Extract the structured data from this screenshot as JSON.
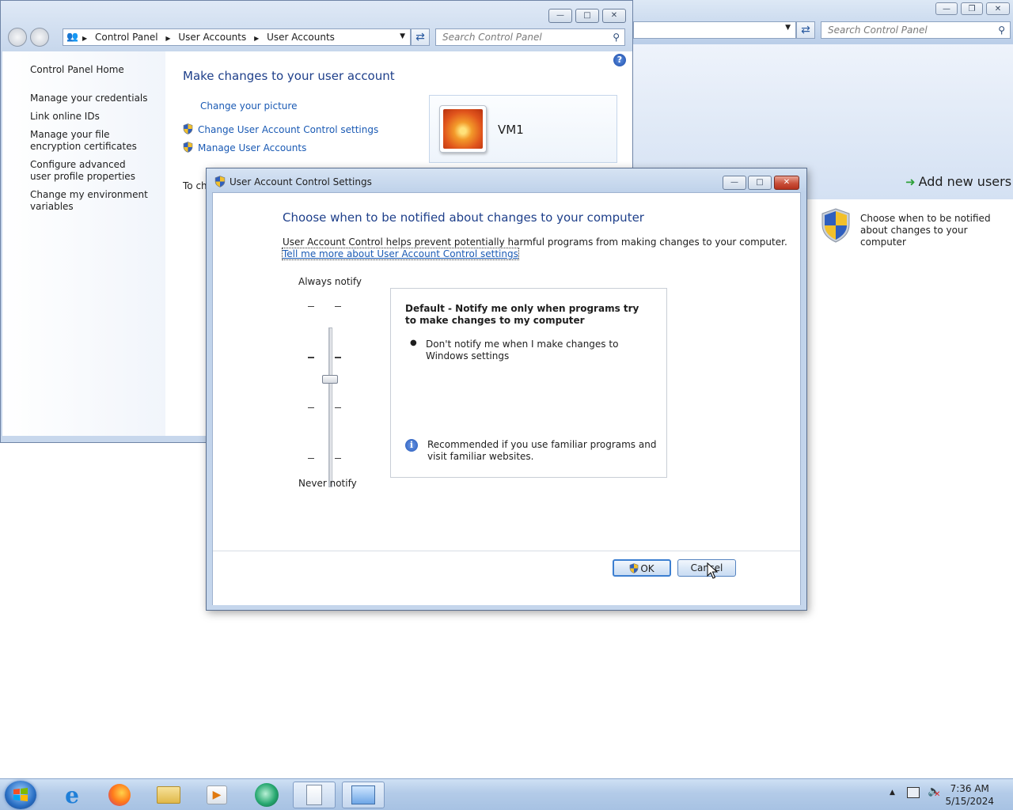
{
  "background_window": {
    "search_placeholder": "Search Control Panel",
    "add_new_users": "Add new users",
    "task_text": "Choose when to be notified about changes to your computer"
  },
  "control_panel": {
    "breadcrumb": [
      "Control Panel",
      "User Accounts",
      "User Accounts"
    ],
    "search_placeholder": "Search Control Panel",
    "sidebar": [
      "Control Panel Home",
      "Manage your credentials",
      "Link online IDs",
      "Manage your file encryption certificates",
      "Configure advanced user profile properties",
      "Change my environment variables"
    ],
    "heading": "Make changes to your user account",
    "links": {
      "change_picture": "Change your picture",
      "change_uac": "Change User Account Control settings",
      "manage_accounts": "Manage User Accounts"
    },
    "partial_text": "To ch",
    "account_name": "VM1"
  },
  "uac_dialog": {
    "title": "User Account Control Settings",
    "heading": "Choose when to be notified about changes to your computer",
    "intro": "User Account Control helps prevent potentially harmful programs from making changes to your computer.",
    "more_link": "Tell me more about User Account Control settings",
    "slider_top_label": "Always notify",
    "slider_bottom_label": "Never notify",
    "slider_level": "2 of 4",
    "desc_title": "Default - Notify me only when programs try to make changes to my computer",
    "desc_bullet": "Don't notify me when I make changes to Windows settings",
    "desc_recommendation": "Recommended if you use familiar programs and visit familiar websites.",
    "ok_label": "OK",
    "cancel_label": "Cancel"
  },
  "taskbar": {
    "time": "7:36 AM",
    "date": "5/15/2024",
    "apps": [
      "windows-start",
      "internet-explorer",
      "firefox",
      "file-explorer",
      "media-player",
      "app-green",
      "notepad",
      "control-panel"
    ]
  },
  "colors": {
    "link_blue": "#1a5ab4",
    "heading_blue": "#1e3f8a",
    "window_frame": "#c7d7ec",
    "taskbar": "#b3cbe8"
  }
}
